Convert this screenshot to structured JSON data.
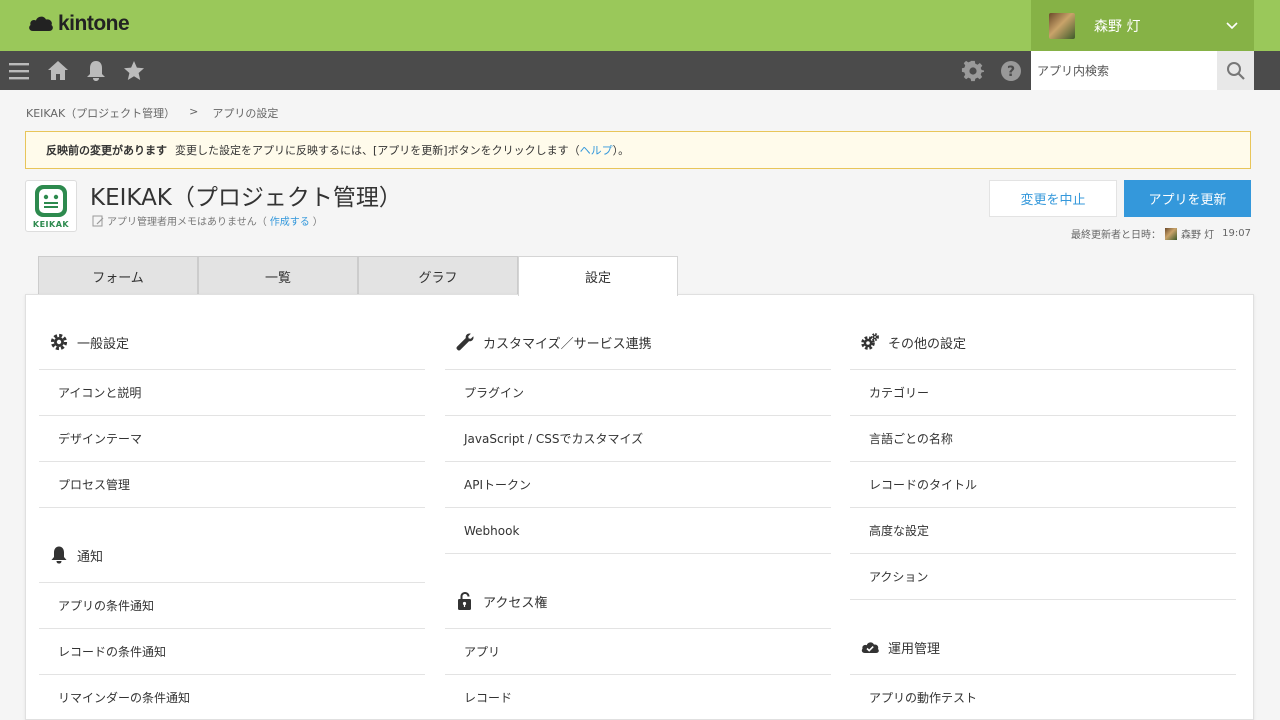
{
  "header": {
    "logo_text": "kintone",
    "user_name": "森野 灯"
  },
  "toolbar": {
    "search_placeholder": "アプリ内検索"
  },
  "breadcrumb": {
    "app": "KEIKAK（プロジェクト管理）",
    "separator": ">",
    "current": "アプリの設定"
  },
  "notice": {
    "title": "反映前の変更があります",
    "text_before": "変更した設定をアプリに反映するには、[アプリを更新]ボタンをクリックします（",
    "help_link": "ヘルプ",
    "text_after": "）。"
  },
  "app": {
    "icon_label": "KEIKAK",
    "title": "KEIKAK（プロジェクト管理）",
    "memo_text": "アプリ管理者用メモはありません（",
    "memo_link": "作成する",
    "memo_close": "）",
    "cancel_label": "変更を中止",
    "update_label": "アプリを更新",
    "last_updated_label": "最終更新者と日時：",
    "last_updated_user": "森野 灯",
    "last_updated_time": "19:07"
  },
  "tabs": [
    {
      "label": "フォーム"
    },
    {
      "label": "一覧"
    },
    {
      "label": "グラフ"
    },
    {
      "label": "設定"
    }
  ],
  "columns": [
    {
      "sections": [
        {
          "icon": "gear-icon",
          "title": "一般設定",
          "items": [
            "アイコンと説明",
            "デザインテーマ",
            "プロセス管理"
          ]
        },
        {
          "icon": "bell-icon",
          "title": "通知",
          "items": [
            "アプリの条件通知",
            "レコードの条件通知",
            "リマインダーの条件通知"
          ]
        }
      ]
    },
    {
      "sections": [
        {
          "icon": "wrench-icon",
          "title": "カスタマイズ／サービス連携",
          "items": [
            "プラグイン",
            "JavaScript / CSSでカスタマイズ",
            "APIトークン",
            "Webhook"
          ]
        },
        {
          "icon": "lock-icon",
          "title": "アクセス権",
          "items": [
            "アプリ",
            "レコード"
          ]
        }
      ]
    },
    {
      "sections": [
        {
          "icon": "gears-icon",
          "title": "その他の設定",
          "items": [
            "カテゴリー",
            "言語ごとの名称",
            "レコードのタイトル",
            "高度な設定",
            "アクション"
          ]
        },
        {
          "icon": "cloud-check-icon",
          "title": "運用管理",
          "items": [
            "アプリの動作テスト"
          ]
        }
      ]
    }
  ]
}
